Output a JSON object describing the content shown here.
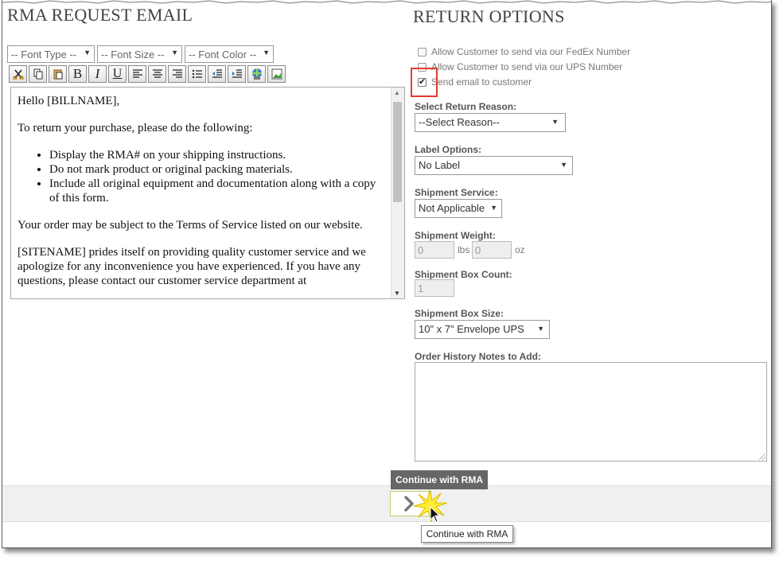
{
  "left_panel": {
    "title": "RMA REQUEST EMAIL",
    "font_type": "-- Font Type --",
    "font_size": "-- Font Size --",
    "font_color": "-- Font Color --",
    "editor": {
      "greeting": "Hello [BILLNAME],",
      "intro": "To return your purchase, please do the following:",
      "bullets": [
        "Display the RMA# on your shipping instructions.",
        "Do not mark product or original packing materials.",
        "Include all original equipment and documentation along with a copy of this form."
      ],
      "terms": "Your order may be subject to the Terms of Service listed on our website.",
      "closing": "[SITENAME] prides itself on providing quality customer service and we apologize for any inconvenience you have experienced.  If you have any questions, please contact our customer service department at"
    }
  },
  "right_panel": {
    "title": "RETURN OPTIONS",
    "options": [
      {
        "label": "Allow Customer to send via our FedEx Number",
        "checked": false
      },
      {
        "label": "Allow Customer to send via our UPS Number",
        "checked": false
      },
      {
        "label": "Send email to customer",
        "checked": true
      }
    ],
    "return_reason": {
      "label": "Select Return Reason:",
      "value": "--Select Reason--"
    },
    "label_options": {
      "label": "Label Options:",
      "value": "No Label"
    },
    "shipment_service": {
      "label": "Shipment Service:",
      "value": "Not Applicable"
    },
    "shipment_weight": {
      "label": "Shipment Weight:",
      "lbs": "0",
      "lbs_unit": "lbs",
      "oz": "0",
      "oz_unit": "oz"
    },
    "box_count": {
      "label": "Shipment Box Count:",
      "value": "1"
    },
    "box_size": {
      "label": "Shipment Box Size:",
      "value": "10\" x 7\" Envelope UPS"
    },
    "notes": {
      "label": "Order History Notes to Add:"
    }
  },
  "footer": {
    "tooltip_dark": "Continue with RMA",
    "tooltip_light": "Continue with RMA"
  },
  "colors": {
    "highlight": "#e53935",
    "button_border": "#b9d36b",
    "tooltip_bg": "#666666"
  }
}
